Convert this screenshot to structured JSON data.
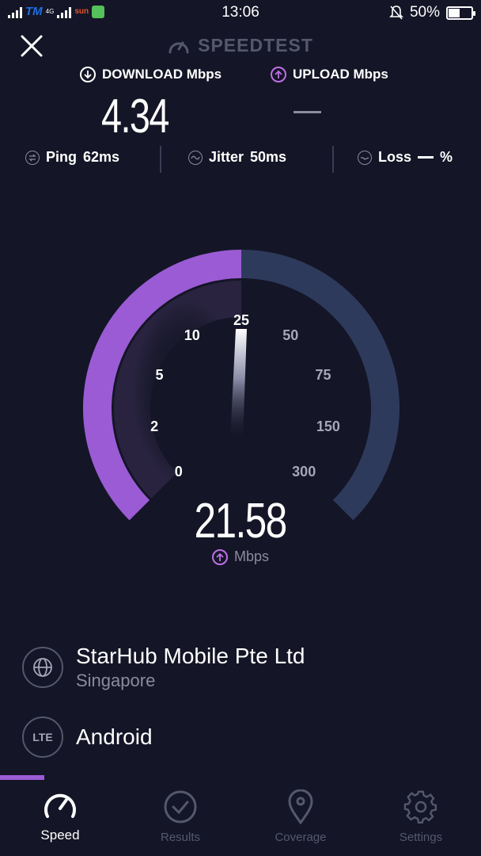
{
  "status_bar": {
    "carrier1": "TM",
    "network": "4G",
    "carrier2": "sun",
    "time": "13:06",
    "battery": "50%",
    "battery_level": 0.5
  },
  "header": {
    "brand": "SPEEDTEST"
  },
  "labels": {
    "download": "DOWNLOAD Mbps",
    "upload": "UPLOAD Mbps"
  },
  "results": {
    "download_value": "4.34"
  },
  "metrics": {
    "ping_label": "Ping",
    "ping_value": "62ms",
    "jitter_label": "Jitter",
    "jitter_value": "50ms",
    "loss_label": "Loss",
    "loss_unit": "%"
  },
  "gauge": {
    "ticks": [
      "0",
      "2",
      "5",
      "10",
      "25",
      "50",
      "75",
      "150",
      "300"
    ],
    "current_value": "21.58",
    "unit": "Mbps",
    "fill_fraction": 0.5,
    "active_color": "#9b5bd4",
    "track_color": "#2e3a5c"
  },
  "provider": {
    "name": "StarHub Mobile Pte Ltd",
    "location": "Singapore"
  },
  "device": {
    "badge": "LTE",
    "name": "Android"
  },
  "nav": {
    "items": [
      {
        "label": "Speed",
        "icon": "speedometer-icon"
      },
      {
        "label": "Results",
        "icon": "check-circle-icon"
      },
      {
        "label": "Coverage",
        "icon": "map-pin-icon"
      },
      {
        "label": "Settings",
        "icon": "gear-icon"
      }
    ]
  }
}
